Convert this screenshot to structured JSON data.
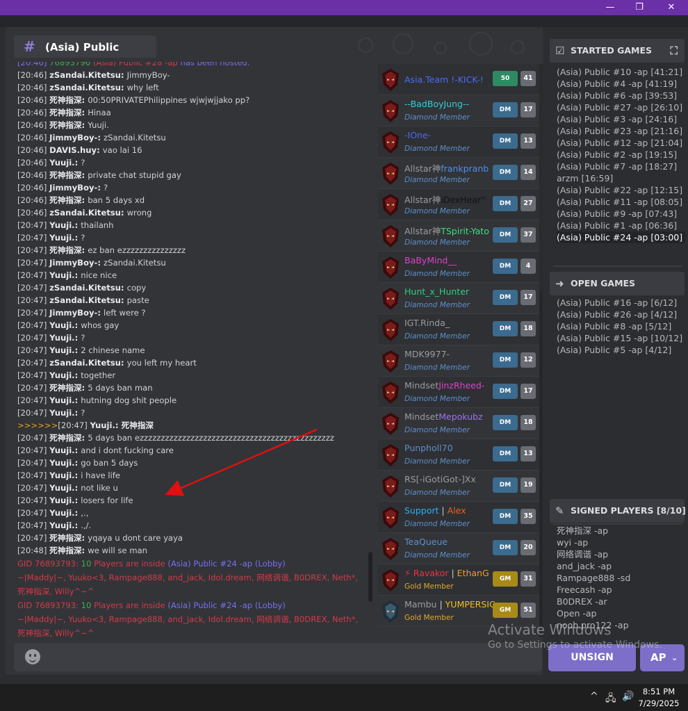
{
  "window": {
    "minimize": "—",
    "restore": "❐",
    "close": "✕"
  },
  "channel": {
    "hash": "#",
    "title": "(Asia) Public"
  },
  "chat": [
    {
      "t": "[20:46]",
      "tc": "#5e8fc8",
      "u": "",
      "m": "",
      "raw": [
        [
          "[20:46] ",
          "#7a6ff0"
        ],
        [
          "76893796 ",
          "#3fae52"
        ],
        [
          "(Asia) Public #28 -ap ",
          "#d43a48"
        ],
        [
          "has been hosted.",
          "#7a6ff0"
        ]
      ],
      "top": true
    },
    {
      "t": "[20:46]",
      "u": "zSandai.Kitetsu",
      "m": "JimmyBoy-"
    },
    {
      "t": "[20:46]",
      "u": "zSandai.Kitetsu",
      "m": "why left"
    },
    {
      "t": "[20:46]",
      "u": "死神指深",
      "m": "00:50PRIVATEPhilippines wjwjwjjako pp?"
    },
    {
      "t": "[20:46]",
      "u": "死神指深",
      "m": "Hinaa"
    },
    {
      "t": "[20:46]",
      "u": "死神指深",
      "m": "Yuuji."
    },
    {
      "t": "[20:46]",
      "u": "JimmyBoy-",
      "m": "zSandai.Kitetsu"
    },
    {
      "t": "[20:46]",
      "u": "DAVIS.huy",
      "m": "vao lai 16"
    },
    {
      "t": "[20:46]",
      "u": "Yuuji.",
      "m": "?"
    },
    {
      "t": "[20:46]",
      "u": "死神指深",
      "m": "private chat stupid gay"
    },
    {
      "t": "[20:46]",
      "u": "JimmyBoy-",
      "m": "?"
    },
    {
      "t": "[20:46]",
      "u": "死神指深",
      "m": "ban 5 days xd"
    },
    {
      "t": "[20:46]",
      "u": "zSandai.Kitetsu",
      "m": "wrong"
    },
    {
      "t": "[20:47]",
      "u": "Yuuji.",
      "m": "thailanh"
    },
    {
      "t": "[20:47]",
      "u": "Yuuji.",
      "m": "?"
    },
    {
      "t": "[20:47]",
      "u": "死神指深",
      "m": "ez ban ezzzzzzzzzzzzzzz"
    },
    {
      "t": "[20:47]",
      "u": "JimmyBoy-",
      "m": "zSandai.Kitetsu"
    },
    {
      "t": "[20:47]",
      "u": "Yuuji.",
      "m": "nice nice"
    },
    {
      "t": "[20:47]",
      "u": "zSandai.Kitetsu",
      "m": "copy"
    },
    {
      "t": "[20:47]",
      "u": "zSandai.Kitetsu",
      "m": "paste"
    },
    {
      "t": "[20:47]",
      "u": "JimmyBoy-",
      "m": "left were ?"
    },
    {
      "t": "[20:47]",
      "u": "Yuuji.",
      "m": "whos gay"
    },
    {
      "t": "[20:47]",
      "u": "Yuuji.",
      "m": "?"
    },
    {
      "t": "[20:47]",
      "u": "Yuuji.",
      "m": "2 chinese name"
    },
    {
      "t": "[20:47]",
      "u": "zSandai.Kitetsu",
      "m": "you left my heart"
    },
    {
      "t": "[20:47]",
      "u": "Yuuji.",
      "m": "together"
    },
    {
      "t": "[20:47]",
      "u": "死神指深",
      "m": "5 days ban man"
    },
    {
      "t": "[20:47]",
      "u": "Yuuji.",
      "m": "hutning dog shit people"
    },
    {
      "t": "[20:47]",
      "u": "Yuuji.",
      "m": "?"
    },
    {
      "t": "[20:47]",
      "prefix": ">>>>>>",
      "u": "Yuuji.",
      "m": "死神指深",
      "bold": true
    },
    {
      "t": "[20:47]",
      "u": "死神指深",
      "m": "5 days ban ezzzzzzzzzzzzzzzzzzzzzzzzzzzzzzzzzzzzzzzzzzzzzz"
    },
    {
      "t": "[20:47]",
      "u": "Yuuji.",
      "m": "and i dont fucking care"
    },
    {
      "t": "[20:47]",
      "u": "Yuuji.",
      "m": "go ban 5 days"
    },
    {
      "t": "[20:47]",
      "u": "Yuuji.",
      "m": "i have life"
    },
    {
      "t": "[20:47]",
      "u": "Yuuji.",
      "m": "not like u"
    },
    {
      "t": "[20:47]",
      "u": "Yuuji.",
      "m": "losers for life"
    },
    {
      "t": "[20:47]",
      "u": "Yuuji.",
      "m": ",.,"
    },
    {
      "t": "[20:47]",
      "u": "Yuuji.",
      "m": ".,/."
    },
    {
      "t": "[20:47]",
      "u": "死神指深",
      "m": "yqaya u dont care yaya"
    },
    {
      "t": "[20:48]",
      "u": "死神指深",
      "m": "we will se man"
    }
  ],
  "system_msgs": [
    {
      "gid": "GID 76893793:",
      "count": "10",
      "inside": "Players are inside",
      "room": "(Asia) Public #24 -ap (Lobby)",
      "players": "~|Maddy|~, Yuuko<3, Rampage888, and_jack, Idol.dream, 网络调谐, B0DREX, Neth*, 死神指深, Willy^~^"
    },
    {
      "gid": "GID 76893793:",
      "count": "10",
      "inside": "Players are inside",
      "room": "(Asia) Public #24 -ap (Lobby)",
      "players": "~|Maddy|~, Yuuko<3, Rampage888, and_jack, Idol.dream, 网络调谐, B0DREX, Neth*, 死神指深, Willy^~^"
    }
  ],
  "players": [
    {
      "name": "Asia.Team  !-KICK-!",
      "name_color": "#4b6cf0",
      "rank": "",
      "badge": "50",
      "badge_type": "lv",
      "level": "41",
      "avatar": "red"
    },
    {
      "name": "--BadBoyJung--",
      "name_color": "#2fd0d8",
      "rank": "Diamond Member",
      "badge": "DM",
      "level": "17",
      "avatar": "red"
    },
    {
      "name": "-IOne-",
      "name_color": "#4b6cf0",
      "rank": "Diamond Member",
      "badge": "DM",
      "level": "13",
      "avatar": "red"
    },
    {
      "name_parts": [
        [
          "Allstar神",
          "#9a9ca2"
        ],
        [
          "frankpranb",
          "#4b8ff0"
        ]
      ],
      "rank": "Diamond Member",
      "badge": "DM",
      "level": "14",
      "avatar": "red"
    },
    {
      "name_parts": [
        [
          "Allstar神",
          "#9a9ca2"
        ],
        [
          "iDexHear''",
          "#111111"
        ]
      ],
      "rank": "Diamond Member",
      "badge": "DM",
      "level": "27",
      "avatar": "red"
    },
    {
      "name_parts": [
        [
          "Allstar神",
          "#9a9ca2"
        ],
        [
          "TSpirit-Yato",
          "#3fe07a"
        ]
      ],
      "rank": "Diamond Member",
      "badge": "DM",
      "level": "37",
      "avatar": "red"
    },
    {
      "name": "BaByMind__",
      "name_color": "#e040c8",
      "rank": "Diamond Member",
      "badge": "DM",
      "level": "4",
      "avatar": "red"
    },
    {
      "name": "Hunt_x_Hunter",
      "name_color": "#2fd080",
      "rank": "Diamond Member",
      "badge": "DM",
      "level": "17",
      "avatar": "red"
    },
    {
      "name": "IGT.Rinda_",
      "name_color": "#9a9ca2",
      "rank": "Diamond Member",
      "badge": "DM",
      "level": "18",
      "avatar": "red"
    },
    {
      "name": "MDK9977-",
      "name_color": "#9a9ca2",
      "rank": "Diamond Member",
      "badge": "DM",
      "level": "12",
      "avatar": "red"
    },
    {
      "name_parts": [
        [
          "Mindset",
          "#9a9ca2"
        ],
        [
          "JinzRheed-",
          "#e040c8"
        ]
      ],
      "rank": "Diamond Member",
      "badge": "DM",
      "level": "17",
      "avatar": "red"
    },
    {
      "name_parts": [
        [
          "Mindset",
          "#9a9ca2"
        ],
        [
          "Mepokubz",
          "#a070f0"
        ]
      ],
      "rank": "Diamond Member",
      "badge": "DM",
      "level": "18",
      "avatar": "red"
    },
    {
      "name": "Punpholl70",
      "name_color": "#5e8fc8",
      "rank": "Diamond Member",
      "badge": "DM",
      "level": "13",
      "avatar": "red"
    },
    {
      "name": "RS[-iGotiGot-]Xx",
      "name_color": "#9a9ca2",
      "rank": "Diamond Member",
      "badge": "DM",
      "level": "19",
      "avatar": "red"
    },
    {
      "name_parts": [
        [
          "Support",
          "#2fb0f0"
        ],
        [
          " | ",
          "#ccc"
        ],
        [
          "Alex",
          "#f06020"
        ]
      ],
      "rank": "Diamond Member",
      "badge": "DM",
      "level": "35",
      "avatar": "red"
    },
    {
      "name": "TeaQueue",
      "name_color": "#5e8fc8",
      "rank": "Diamond Member",
      "badge": "DM",
      "level": "20",
      "avatar": "red"
    },
    {
      "name_parts": [
        [
          "⚡ Ravakor",
          "#f03040"
        ],
        [
          " | ",
          "#ccc"
        ],
        [
          "EthanG",
          "#f0a020"
        ],
        [
          " +",
          "#40d080"
        ]
      ],
      "rank": "Gold Member",
      "gold": true,
      "badge": "GM",
      "badge_type": "gm",
      "level": "31",
      "avatar": "red"
    },
    {
      "name_parts": [
        [
          "Mambu",
          "#9a9ca2"
        ],
        [
          " | ",
          "#ccc"
        ],
        [
          "YUMPERSIC(",
          "#f0c020"
        ]
      ],
      "rank": "Gold Member",
      "gold": true,
      "badge": "GM",
      "badge_type": "gm",
      "level": "51",
      "avatar": "blue"
    }
  ],
  "started_games": {
    "title": "STARTED GAMES",
    "items": [
      "(Asia) Public #10 -ap [41:21]",
      "(Asia) Public #4 -ap [41:19]",
      "(Asia) Public #6 -ap [39:53]",
      "(Asia) Public #27 -ap [26:10]",
      "(Asia) Public #3 -ap [24:16]",
      "(Asia) Public #23 -ap [21:16]",
      "(Asia) Public #12 -ap [21:04]",
      "(Asia) Public #2 -ap [19:15]",
      "(Asia) Public #7 -ap [18:27]",
      "arzm [16:59]",
      "(Asia) Public #22 -ap [12:15]",
      "(Asia) Public #11 -ap [08:05]",
      "(Asia) Public #9 -ap [07:43]",
      "(Asia) Public #1 -ap [06:36]",
      "(Asia) Public #24 -ap [03:00]"
    ],
    "selected": 14
  },
  "open_games": {
    "title": "OPEN GAMES",
    "items": [
      "(Asia) Public #16 -ap [6/12]",
      "(Asia) Public #26 -ap [4/12]",
      "(Asia) Public #8 -ap [5/12]",
      "(Asia) Public #15 -ap [10/12]",
      "(Asia) Public #5 -ap [4/12]"
    ]
  },
  "signed_players": {
    "title": "SIGNED PLAYERS [8/10]",
    "items": [
      "死神指深 -ap",
      "wyi -ap",
      "网络调谐 -ap",
      "and_jack -ap",
      "Rampage888 -sd",
      "Freecash -ap",
      "B0DREX -ar",
      "Open -ap",
      "noob.pro122 -ap"
    ]
  },
  "buttons": {
    "unsign": "UNSIGN",
    "mode": "AP"
  },
  "watermark": {
    "line1": "Activate Windows",
    "line2": "Go to Settings to activate Windows."
  },
  "taskbar": {
    "time": "8:51 PM",
    "date": "7/29/2025"
  }
}
